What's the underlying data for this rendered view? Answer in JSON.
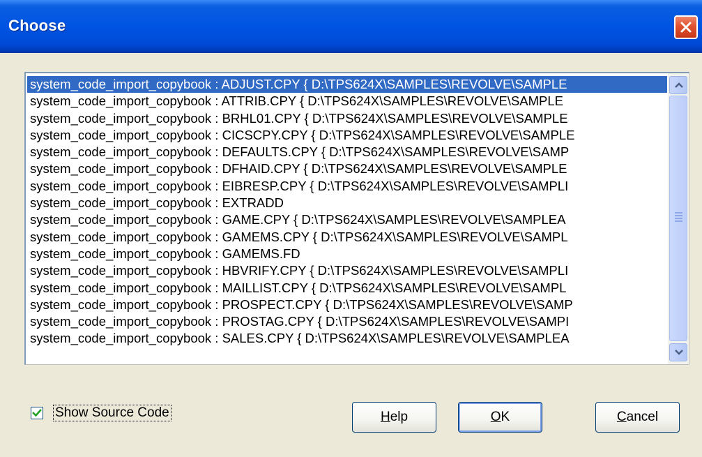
{
  "window": {
    "title": "Choose"
  },
  "list": {
    "items": [
      {
        "label": "system_code_import_copybook :  ADJUST.CPY { D:\\TPS624X\\SAMPLES\\REVOLVE\\SAMPLE",
        "selected": true
      },
      {
        "label": "system_code_import_copybook :  ATTRIB.CPY { D:\\TPS624X\\SAMPLES\\REVOLVE\\SAMPLE",
        "selected": false
      },
      {
        "label": "system_code_import_copybook :  BRHL01.CPY { D:\\TPS624X\\SAMPLES\\REVOLVE\\SAMPLE",
        "selected": false
      },
      {
        "label": "system_code_import_copybook :  CICSCPY.CPY { D:\\TPS624X\\SAMPLES\\REVOLVE\\SAMPLE",
        "selected": false
      },
      {
        "label": "system_code_import_copybook :  DEFAULTS.CPY { D:\\TPS624X\\SAMPLES\\REVOLVE\\SAMP",
        "selected": false
      },
      {
        "label": "system_code_import_copybook :  DFHAID.CPY { D:\\TPS624X\\SAMPLES\\REVOLVE\\SAMPLE",
        "selected": false
      },
      {
        "label": "system_code_import_copybook :  EIBRESP.CPY { D:\\TPS624X\\SAMPLES\\REVOLVE\\SAMPLI",
        "selected": false
      },
      {
        "label": "system_code_import_copybook :  EXTRADD",
        "selected": false
      },
      {
        "label": "system_code_import_copybook :  GAME.CPY   { D:\\TPS624X\\SAMPLES\\REVOLVE\\SAMPLEA",
        "selected": false
      },
      {
        "label": "system_code_import_copybook :  GAMEMS.CPY { D:\\TPS624X\\SAMPLES\\REVOLVE\\SAMPL",
        "selected": false
      },
      {
        "label": "system_code_import_copybook :  GAMEMS.FD",
        "selected": false
      },
      {
        "label": "system_code_import_copybook :  HBVRIFY.CPY { D:\\TPS624X\\SAMPLES\\REVOLVE\\SAMPLI",
        "selected": false
      },
      {
        "label": "system_code_import_copybook :  MAILLIST.CPY { D:\\TPS624X\\SAMPLES\\REVOLVE\\SAMPL",
        "selected": false
      },
      {
        "label": "system_code_import_copybook :  PROSPECT.CPY { D:\\TPS624X\\SAMPLES\\REVOLVE\\SAMP",
        "selected": false
      },
      {
        "label": "system_code_import_copybook :  PROSTAG.CPY { D:\\TPS624X\\SAMPLES\\REVOLVE\\SAMPI",
        "selected": false
      },
      {
        "label": "system_code_import_copybook :  SALES.CPY  { D:\\TPS624X\\SAMPLES\\REVOLVE\\SAMPLEA",
        "selected": false
      }
    ]
  },
  "options": {
    "show_source_label": "Show Source Code",
    "show_source_checked": true
  },
  "buttons": {
    "help": {
      "pre": "",
      "accel": "H",
      "post": "elp"
    },
    "ok": {
      "pre": "",
      "accel": "O",
      "post": "K"
    },
    "cancel": {
      "pre": "",
      "accel": "C",
      "post": "ancel"
    }
  },
  "icons": {
    "close": "close-icon",
    "scroll_up": "chevron-up-icon",
    "scroll_down": "chevron-down-icon",
    "check": "checkmark-icon"
  },
  "colors": {
    "selection": "#316ac5",
    "titlebar": "#0054e3",
    "close": "#e0512e"
  }
}
